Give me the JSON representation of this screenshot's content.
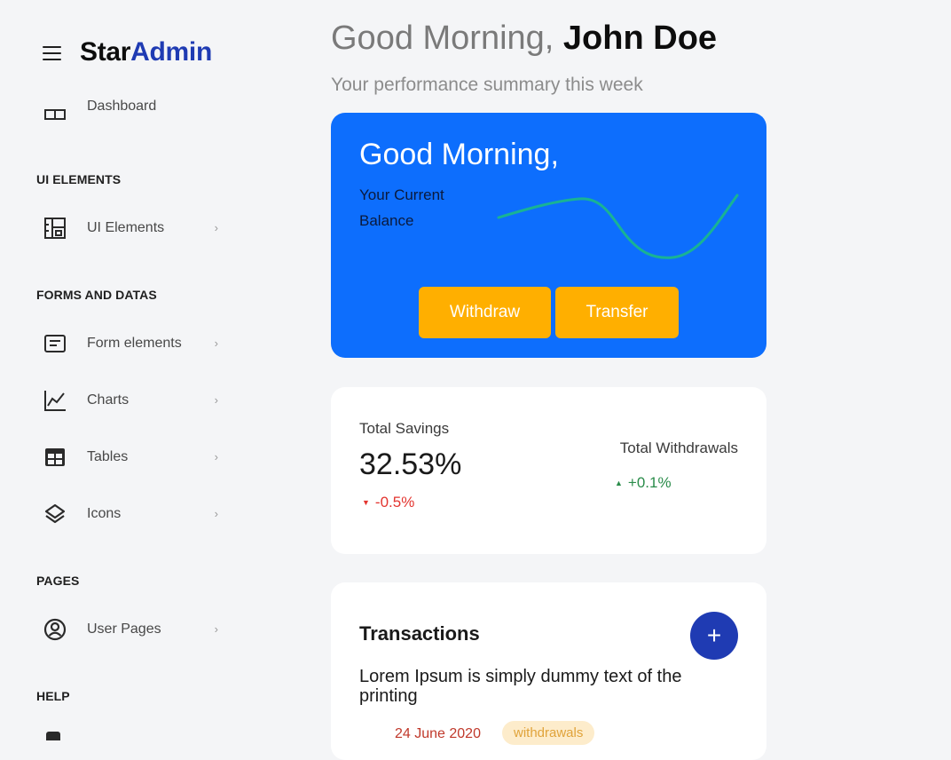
{
  "brand": {
    "part1": "Star",
    "part2": "Admin"
  },
  "sidebar": {
    "dashboard": {
      "label": "Dashboard"
    },
    "sections": {
      "ui": "UI ELEMENTS",
      "forms": "FORMS AND DATAS",
      "pages": "PAGES",
      "help": "HELP"
    },
    "items": {
      "ui_elements": {
        "label": "UI Elements",
        "icon": "layout-icon"
      },
      "form_elements": {
        "label": "Form elements",
        "icon": "form-icon"
      },
      "charts": {
        "label": "Charts",
        "icon": "chart-line-icon"
      },
      "tables": {
        "label": "Tables",
        "icon": "table-icon"
      },
      "icons": {
        "label": "Icons",
        "icon": "layers-icon"
      },
      "user_pages": {
        "label": "User Pages",
        "icon": "user-circle-icon"
      }
    },
    "chevron": "›"
  },
  "header": {
    "greeting": "Good Morning, ",
    "name": "John Doe",
    "subtitle": "Your performance summary this week"
  },
  "balance_card": {
    "title": "Good Morning,",
    "balance_label": "Your Current Balance",
    "withdraw_label": "Withdraw",
    "transfer_label": "Transfer",
    "colors": {
      "background": "#0d6efd",
      "button": "#ffaf00",
      "sparkline": "#19b394"
    }
  },
  "savings_card": {
    "total_savings_label": "Total Savings",
    "total_savings_value": "32.53%",
    "total_savings_delta": "-0.5%",
    "total_withdrawals_label": "Total Withdrawals",
    "total_withdrawals_delta": "+0.1%",
    "down_arrow": "▼",
    "up_arrow": "▲"
  },
  "transactions": {
    "title": "Transactions",
    "add_label": "+",
    "description": "Lorem Ipsum is simply dummy text of the printing",
    "date": "24 June 2020",
    "badge": "withdrawals"
  }
}
